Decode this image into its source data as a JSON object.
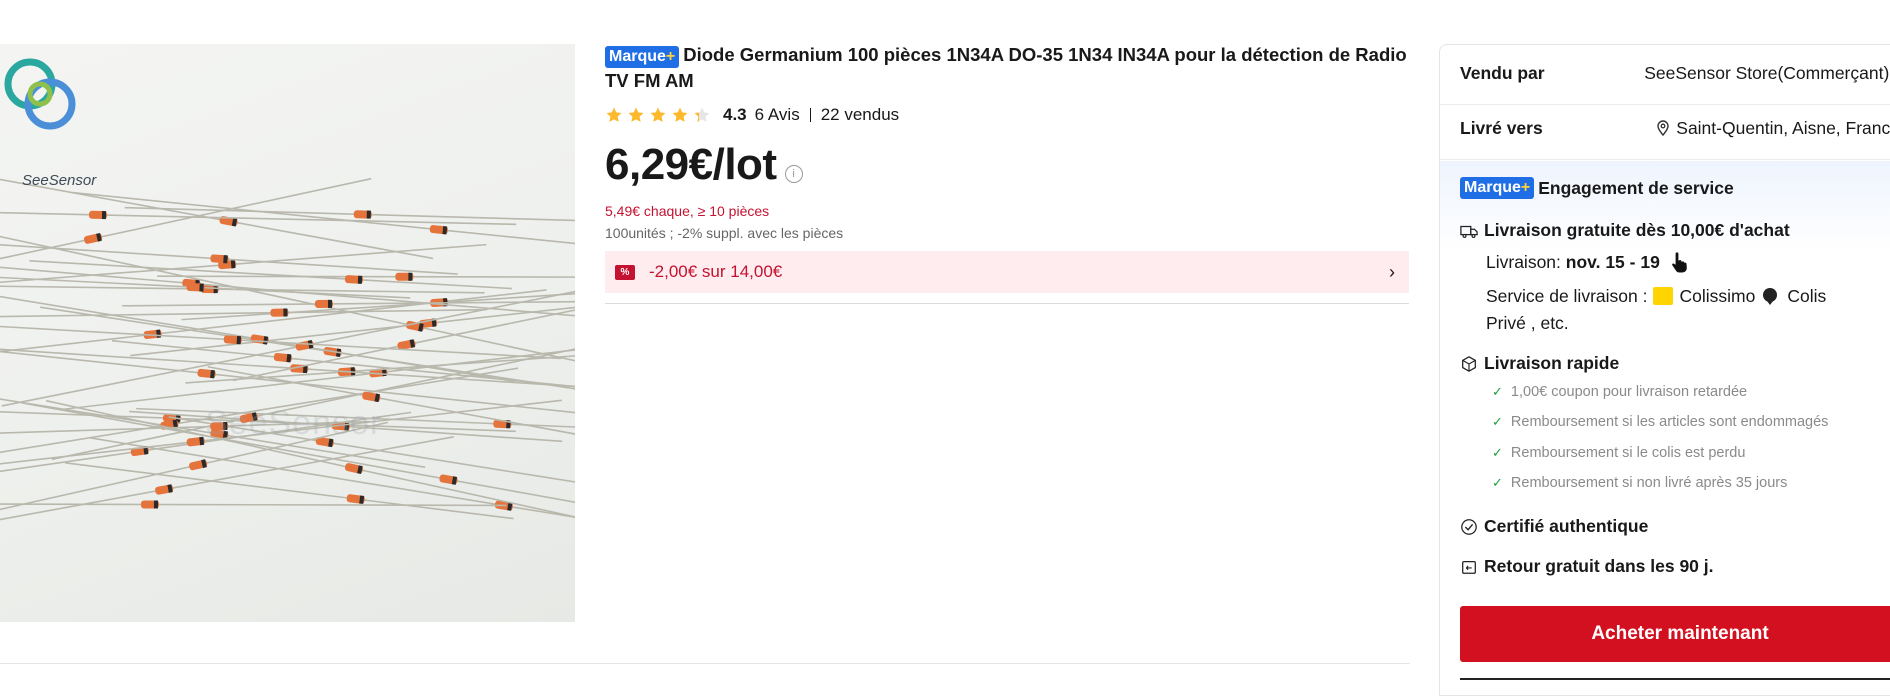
{
  "product": {
    "brand_badge": "Marque",
    "brand_badge_plus": "+",
    "title": "Diode Germanium 100 pièces 1N34A DO-35 1N34 IN34A pour la détection de Radio TV FM AM",
    "rating_value": "4.3",
    "rating": 4.3,
    "reviews": "6 Avis",
    "sold": "22 vendus",
    "price": "6,29€/lot",
    "bulk_price": "5,49€ chaque, ≥ 10 pièces",
    "units_info": "100unités ; -2% suppl. avec les pièces",
    "promo": "-2,00€ sur 14,00€",
    "coupon_icon_text": "%"
  },
  "image": {
    "logo_text": "SeeSensor",
    "watermark": "SeeSensor"
  },
  "panel": {
    "sold_by_label": "Vendu par",
    "seller": "SeeSensor Store(Commerçant)",
    "ship_to_label": "Livré vers",
    "ship_to": "Saint-Quentin, Aisne, France",
    "service_badge": "Marque",
    "service_badge_plus": "+",
    "service_title": "Engagement de service",
    "free_shipping": "Livraison gratuite dès 10,00€ d'achat",
    "delivery_label": "Livraison:",
    "delivery_dates": "nov. 15 - 19",
    "carrier_label": "Service de livraison :",
    "carrier_1": "Colissimo",
    "carrier_2": "Colis",
    "carrier_2_cont": "Privé , etc.",
    "fast_delivery": "Livraison rapide",
    "guarantees": [
      "1,00€ coupon pour livraison retardée",
      "Remboursement si les articles sont endommagés",
      "Remboursement si le colis est perdu",
      "Remboursement si non livré après 35 jours"
    ],
    "certified": "Certifié authentique",
    "free_return": "Retour gratuit dans les 90 j.",
    "buy_now": "Acheter maintenant"
  },
  "colors": {
    "accent_red": "#d3101f",
    "badge_blue": "#1f6ee5",
    "star_yellow": "#fdb92c",
    "promo_bg": "#ffecee"
  }
}
